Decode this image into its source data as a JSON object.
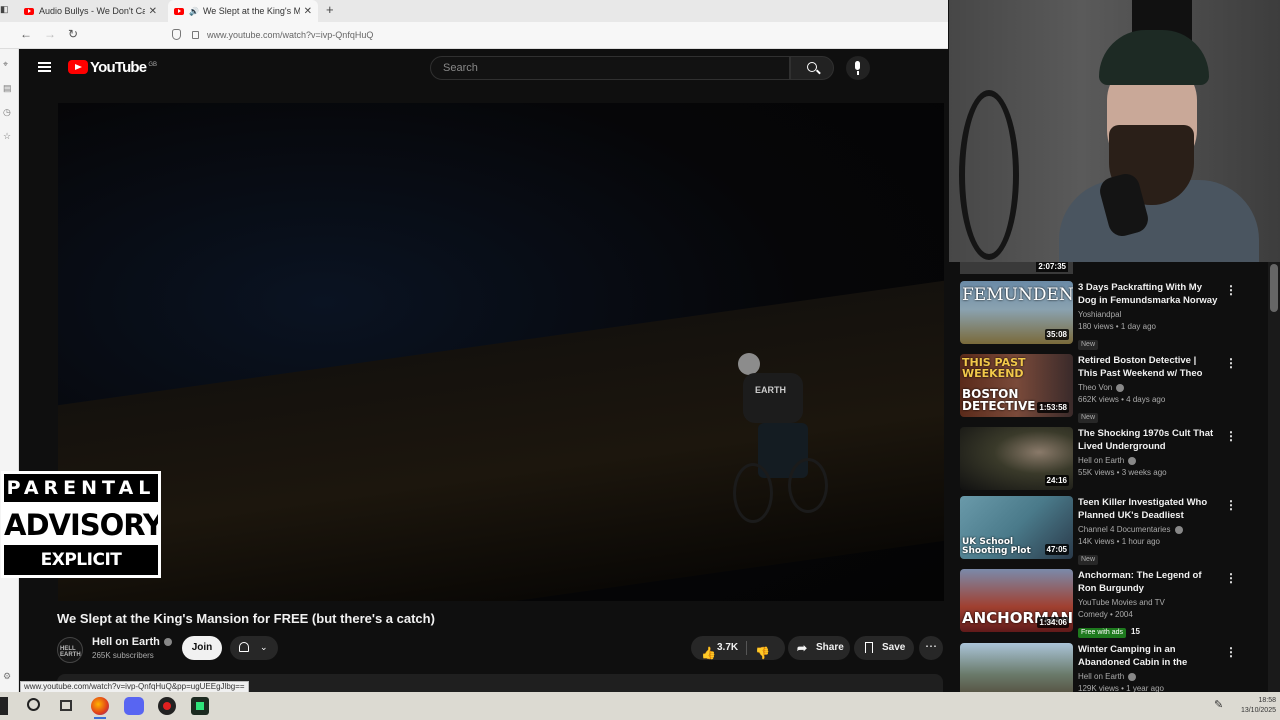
{
  "browser": {
    "tabs": [
      {
        "label": "Audio Bullys - We Don't Care (C",
        "active": false
      },
      {
        "label": "We Slept at the King's Mansi",
        "active": true
      }
    ],
    "new_tab": "+",
    "url": "www.youtube.com/watch?v=ivp-QnfqHuQ",
    "status_url": "www.youtube.com/watch?v=ivp-QnfqHuQ&pp=ugUEEgJlbg=="
  },
  "youtube": {
    "logo_text": "YouTube",
    "region": "GB",
    "search_placeholder": "Search",
    "video_title": "We Slept at the King's Mansion for FREE (but there's a catch)",
    "overlay_text": "EARTH",
    "channel": {
      "avatar_text": "HELL EARTH",
      "name": "Hell on Earth",
      "subscribers": "265K subscribers",
      "join_label": "Join"
    },
    "actions": {
      "likes": "3.7K",
      "share_label": "Share",
      "save_label": "Save"
    }
  },
  "advisory": {
    "line1": "PARENTAL",
    "line2": "ADVISORY",
    "line3": "EXPLICIT CONTENT"
  },
  "recommendations": {
    "top_duration": "2:07:35",
    "items": [
      {
        "title": "3 Days Packrafting With My Dog in Femundsmarka Norway | ...",
        "channel": "Yoshiandpal",
        "meta": "180 views • 1 day ago",
        "badge": "New",
        "duration": "35:08",
        "thumb_text": "FEMUNDEN",
        "verified": false
      },
      {
        "title": "Retired Boston Detective | This Past Weekend w/ Theo Von ...",
        "channel": "Theo Von",
        "meta": "662K views • 4 days ago",
        "badge": "New",
        "duration": "1:53:58",
        "thumb_text": "BOSTON DETECTIVE",
        "thumb_text_top": "THIS PAST WEEKEND",
        "verified": true
      },
      {
        "title": "The Shocking 1970s Cult That Lived Underground",
        "channel": "Hell on Earth",
        "meta": "55K views • 3 weeks ago",
        "badge": "",
        "duration": "24:16",
        "thumb_text": "",
        "verified": true
      },
      {
        "title": "Teen Killer Investigated Who Planned UK's Deadliest School...",
        "channel": "Channel 4 Documentaries",
        "meta": "14K views • 1 hour ago",
        "badge": "New",
        "duration": "47:05",
        "thumb_text": "UK School Shooting Plot",
        "verified": true
      },
      {
        "title": "Anchorman: The Legend of Ron Burgundy",
        "channel": "YouTube Movies and TV",
        "meta": "Comedy • 2004",
        "badge": "Free with ads",
        "badge_extra": "15",
        "duration": "1:34:06",
        "thumb_text": "ANCHORMAN",
        "verified": false
      },
      {
        "title": "Winter Camping in an Abandoned Cabin in the Woods",
        "channel": "Hell on Earth",
        "meta": "129K views • 1 year ago",
        "badge": "",
        "duration": "",
        "thumb_text": "",
        "verified": true
      }
    ]
  },
  "taskbar": {
    "time": "18:58",
    "date": "13/10/2025"
  },
  "colors": {
    "youtube_red": "#ff0000",
    "background": "#0f0f0f",
    "free_with_ads": "#1e7a1e"
  }
}
